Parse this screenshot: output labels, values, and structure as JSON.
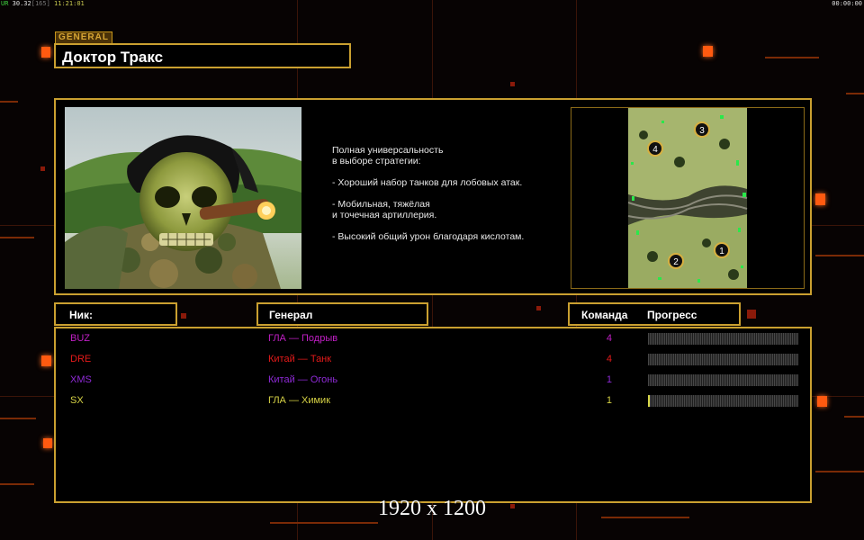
{
  "status_bar": {
    "left_parts": [
      "UR",
      "30.32",
      "[165]",
      "11:21:01"
    ],
    "right": "00:00:00"
  },
  "general_tag": "GENERAL",
  "general_name": "Доктор Тракс",
  "description_lines": [
    "Полная универсальность",
    "в выборе стратегии:",
    "",
    "- Хороший набор танков для лобовых атак.",
    "",
    "- Мобильная, тяжёлая",
    "и точечная артиллерия.",
    "",
    "- Высокий общий урон благодаря кислотам."
  ],
  "minimap": {
    "start_positions": [
      "1",
      "2",
      "3",
      "4"
    ]
  },
  "table": {
    "headers": {
      "nick": "Ник:",
      "general": "Генерал",
      "team": "Команда",
      "progress": "Прогресс"
    },
    "rows": [
      {
        "nick": "BUZ",
        "general": "ГЛА — Подрыв",
        "team": "4",
        "progress": 0,
        "color": "#c21fc6"
      },
      {
        "nick": "DRE",
        "general": "Китай — Танк",
        "team": "4",
        "progress": 0,
        "color": "#e51a1a"
      },
      {
        "nick": "XMS",
        "general": "Китай — Огонь",
        "team": "1",
        "progress": 0,
        "color": "#8e2ad6"
      },
      {
        "nick": "SX",
        "general": "ГЛА — Химик",
        "team": "1",
        "progress": 0.01,
        "color": "#d6d245"
      }
    ]
  },
  "resolution_label": "1920 x 1200"
}
